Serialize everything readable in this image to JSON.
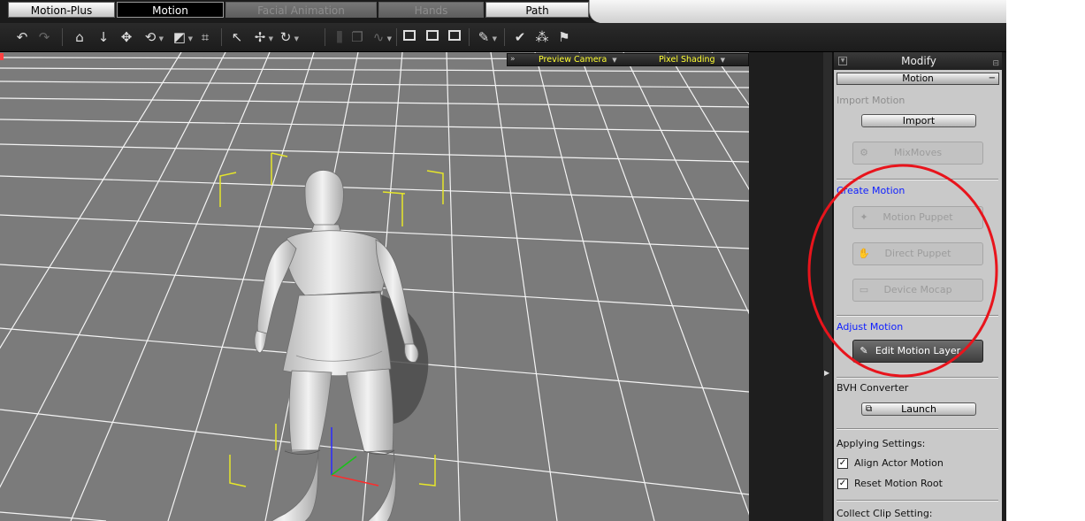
{
  "tabs": [
    {
      "label": "Motion-Plus",
      "state": "normal"
    },
    {
      "label": "Motion",
      "state": "active"
    },
    {
      "label": "Facial Animation",
      "state": "disabled"
    },
    {
      "label": "Hands",
      "state": "disabled"
    },
    {
      "label": "Path",
      "state": "normal"
    }
  ],
  "toolbar": {
    "icons": [
      "undo-icon",
      "redo-icon",
      "home-icon",
      "move-down-icon",
      "move-icon",
      "rotate-icon",
      "scale-icon",
      "frame-icon",
      "select-icon",
      "transform-icon",
      "orbit-icon",
      "align-icon",
      "copy-icon",
      "graph-icon",
      "window-icon",
      "camera-icon",
      "fit-icon",
      "brush-icon",
      "check-icon",
      "crowd-icon",
      "flag-icon"
    ]
  },
  "viewport": {
    "camera_label": "Preview Camera",
    "shading_label": "Pixel Shading",
    "grid_color": "#ffffff",
    "floor_color": "#7b7b7b",
    "selection_color": "#e6e62a"
  },
  "panel": {
    "title": "Modify",
    "rollout": "Motion",
    "import_motion": {
      "heading": "Import Motion",
      "import_button": "Import",
      "mixmoves_button": "MixMoves"
    },
    "create_motion": {
      "heading": "Create Motion",
      "motion_puppet": "Motion Puppet",
      "direct_puppet": "Direct Puppet",
      "device_mocap": "Device Mocap"
    },
    "adjust_motion": {
      "heading": "Adjust Motion",
      "edit_button": "Edit Motion Layer"
    },
    "bvh": {
      "heading": "BVH Converter",
      "launch_button": "Launch"
    },
    "applying": {
      "heading": "Applying Settings:",
      "options": [
        {
          "label": "Align Actor Motion",
          "checked": true
        },
        {
          "label": "Reset Motion Root",
          "checked": true
        }
      ]
    },
    "collect_clip": {
      "heading": "Collect Clip Setting:"
    }
  },
  "annotation": {
    "color": "#e8141c"
  }
}
